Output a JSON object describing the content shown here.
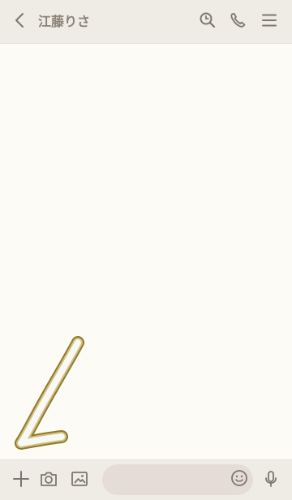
{
  "header": {
    "title": "江藤りさ",
    "icons": [
      "back-icon",
      "search-icon",
      "phone-icon",
      "menu-icon"
    ]
  },
  "footer": {
    "icons": [
      "plus-icon",
      "camera-icon",
      "image-icon",
      "emoji-icon",
      "mic-icon"
    ],
    "message_placeholder": ""
  },
  "theme": {
    "header_bg": "#efece6",
    "chat_bg": "#fdfbf6",
    "footer_bg": "#efece6",
    "input_bg": "#e5dcd7",
    "icon_color": "#7c766d",
    "header_text": "#8a8276",
    "accent_gold": "#b59a3a"
  }
}
